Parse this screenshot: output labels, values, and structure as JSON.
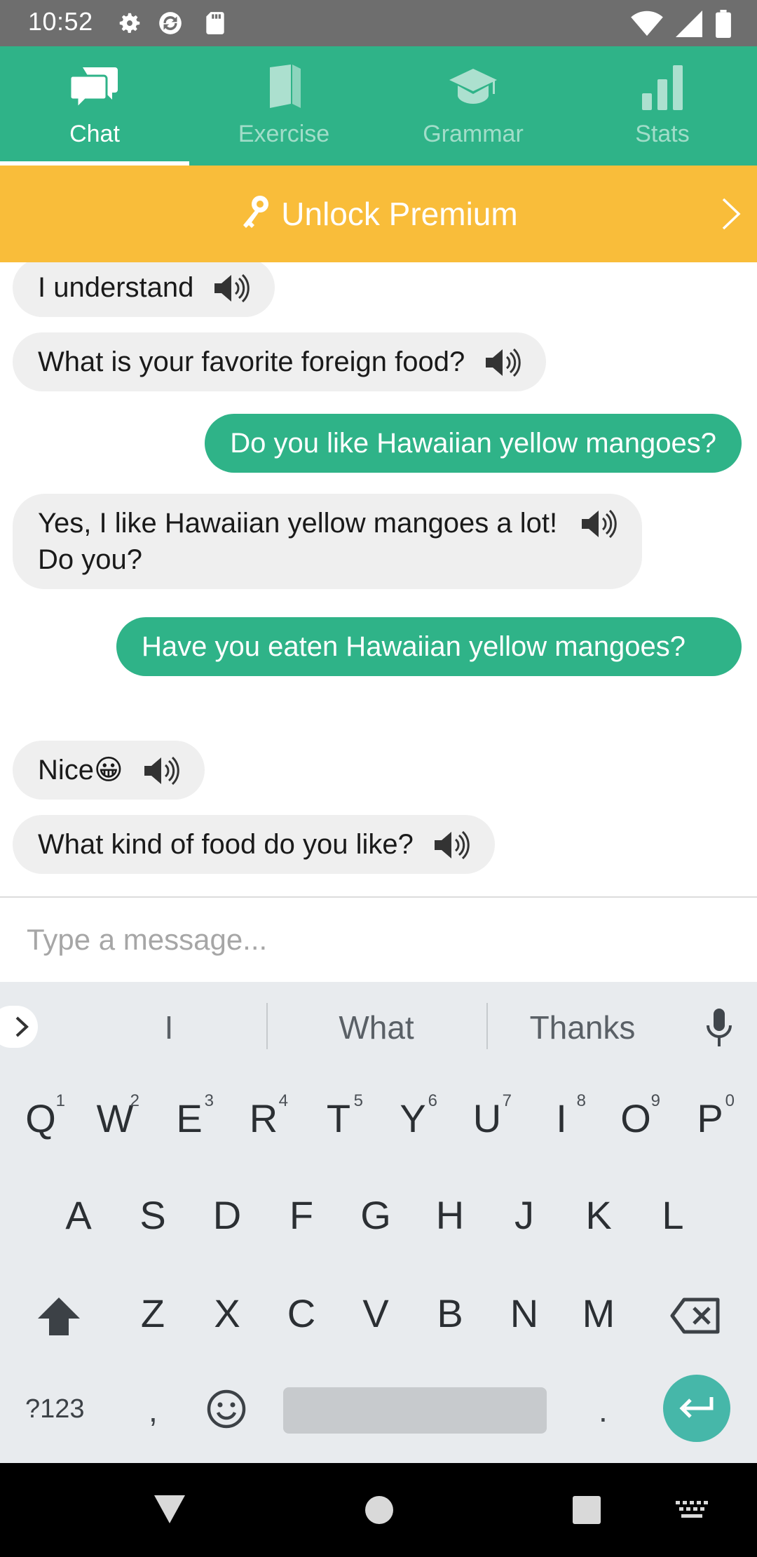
{
  "status_bar": {
    "time": "10:52",
    "icons": [
      "settings-icon",
      "sync-icon",
      "sd-card-icon",
      "wifi-icon",
      "signal-icon",
      "battery-icon"
    ]
  },
  "tabs": [
    {
      "label": "Chat",
      "icon": "chat-icon",
      "active": true
    },
    {
      "label": "Exercise",
      "icon": "book-icon",
      "active": false
    },
    {
      "label": "Grammar",
      "icon": "graduation-cap-icon",
      "active": false
    },
    {
      "label": "Stats",
      "icon": "bar-chart-icon",
      "active": false
    }
  ],
  "premium_banner": {
    "label": "Unlock Premium",
    "color": "#f9bd3a"
  },
  "messages": [
    {
      "from": "bot",
      "text": "I understand"
    },
    {
      "from": "bot",
      "text": "What is your favorite foreign food?"
    },
    {
      "from": "user",
      "text": "Do you like Hawaiian yellow mangoes?"
    },
    {
      "from": "bot",
      "text": "Yes, I like Hawaiian yellow mangoes a lot! Do you?"
    },
    {
      "from": "user",
      "text": "Have you eaten Hawaiian yellow mangoes?"
    },
    {
      "from": "bot",
      "text": "Nice😀"
    },
    {
      "from": "bot",
      "text": "What kind of food do you like?"
    }
  ],
  "composer": {
    "placeholder": "Type a message...",
    "value": ""
  },
  "keyboard": {
    "suggestions": [
      "I",
      "What",
      "Thanks"
    ],
    "row1": [
      {
        "key": "Q",
        "num": "1"
      },
      {
        "key": "W",
        "num": "2"
      },
      {
        "key": "E",
        "num": "3"
      },
      {
        "key": "R",
        "num": "4"
      },
      {
        "key": "T",
        "num": "5"
      },
      {
        "key": "Y",
        "num": "6"
      },
      {
        "key": "U",
        "num": "7"
      },
      {
        "key": "I",
        "num": "8"
      },
      {
        "key": "O",
        "num": "9"
      },
      {
        "key": "P",
        "num": "0"
      }
    ],
    "row2": [
      "A",
      "S",
      "D",
      "F",
      "G",
      "H",
      "J",
      "K",
      "L"
    ],
    "row3": [
      "Z",
      "X",
      "C",
      "V",
      "B",
      "N",
      "M"
    ],
    "symbols_label": "?123",
    "comma": ",",
    "period": "."
  },
  "colors": {
    "accent": "#2fb388",
    "premium": "#f9bd3a",
    "incoming_bubble": "#efefef",
    "enter_key": "#46b7a9"
  }
}
